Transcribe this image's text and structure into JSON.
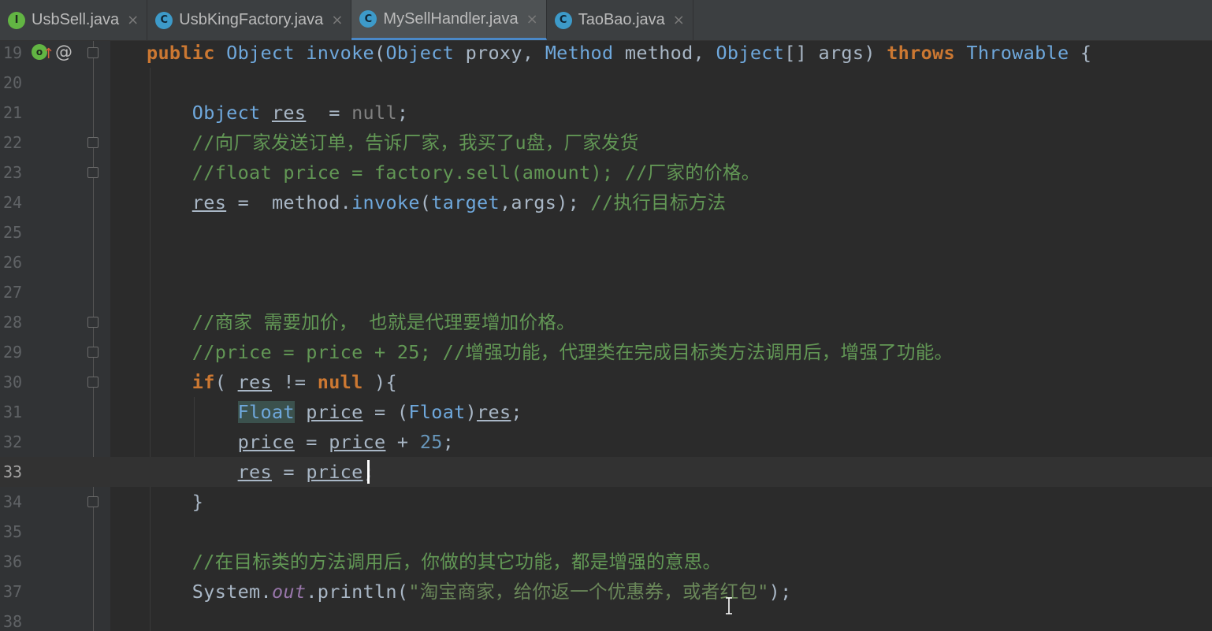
{
  "tabs": [
    {
      "icon": "interface-icon",
      "icon_letter": "I",
      "name": "UsbSell.java",
      "close": "×",
      "active": false
    },
    {
      "icon": "class-icon",
      "icon_letter": "C",
      "name": "UsbKingFactory.java",
      "close": "×",
      "active": false
    },
    {
      "icon": "class-icon",
      "icon_letter": "C",
      "name": "MySellHandler.java",
      "close": "×",
      "active": true
    },
    {
      "icon": "class-icon",
      "icon_letter": "C",
      "name": "TaoBao.java",
      "close": "×",
      "active": false
    }
  ],
  "gutter": {
    "line19_icons": [
      "override-icon",
      "arrow-up-icon",
      "annotation-at-icon"
    ],
    "override_letter": "o",
    "arrow": "↑",
    "at": "@"
  },
  "editor": {
    "current_line": 33,
    "lines": [
      {
        "n": "19",
        "tokens": [
          {
            "t": "public ",
            "c": "kw"
          },
          {
            "t": "Object",
            "c": "tyb"
          },
          {
            "t": " invoke",
            "c": "tyb"
          },
          {
            "t": "(",
            "c": "ty"
          },
          {
            "t": "Object",
            "c": "tyb"
          },
          {
            "t": " proxy, ",
            "c": "ty"
          },
          {
            "t": "Method",
            "c": "tyb"
          },
          {
            "t": " method, ",
            "c": "ty"
          },
          {
            "t": "Object",
            "c": "tyb"
          },
          {
            "t": "[] args) ",
            "c": "ty"
          },
          {
            "t": "throws ",
            "c": "kw"
          },
          {
            "t": "Throwable",
            "c": "tyb"
          },
          {
            "t": " {",
            "c": "ty"
          }
        ]
      },
      {
        "n": "20",
        "tokens": []
      },
      {
        "n": "21",
        "tokens": [
          {
            "t": "    ",
            "c": "ty"
          },
          {
            "t": "Object",
            "c": "tyb"
          },
          {
            "t": " ",
            "c": "ty"
          },
          {
            "t": "res",
            "c": "var"
          },
          {
            "t": "  = ",
            "c": "ty"
          },
          {
            "t": "null",
            "c": "nulg"
          },
          {
            "t": ";",
            "c": "ty"
          }
        ]
      },
      {
        "n": "22",
        "tokens": [
          {
            "t": "    //向厂家发送订单，告诉厂家，我买了u盘，厂家发货",
            "c": "cm"
          }
        ]
      },
      {
        "n": "23",
        "tokens": [
          {
            "t": "    //float price = factory.sell(amount); //厂家的价格。",
            "c": "cm"
          }
        ]
      },
      {
        "n": "24",
        "tokens": [
          {
            "t": "    ",
            "c": "ty"
          },
          {
            "t": "res",
            "c": "var"
          },
          {
            "t": " =  method.",
            "c": "ty"
          },
          {
            "t": "invoke",
            "c": "tyb"
          },
          {
            "t": "(",
            "c": "ty"
          },
          {
            "t": "target",
            "c": "tyb"
          },
          {
            "t": ",args); ",
            "c": "ty"
          },
          {
            "t": "//执行目标方法",
            "c": "cm"
          }
        ]
      },
      {
        "n": "25",
        "tokens": []
      },
      {
        "n": "26",
        "tokens": []
      },
      {
        "n": "27",
        "tokens": []
      },
      {
        "n": "28",
        "tokens": [
          {
            "t": "    //商家 需要加价， 也就是代理要增加价格。",
            "c": "cm"
          }
        ]
      },
      {
        "n": "29",
        "tokens": [
          {
            "t": "    //price = price + 25; //增强功能，代理类在完成目标类方法调用后，增强了功能。",
            "c": "cm"
          }
        ]
      },
      {
        "n": "30",
        "tokens": [
          {
            "t": "    ",
            "c": "ty"
          },
          {
            "t": "if",
            "c": "kw"
          },
          {
            "t": "( ",
            "c": "ty"
          },
          {
            "t": "res",
            "c": "var"
          },
          {
            "t": " != ",
            "c": "ty"
          },
          {
            "t": "null",
            "c": "nul"
          },
          {
            "t": " ){",
            "c": "ty"
          }
        ]
      },
      {
        "n": "31",
        "tokens": [
          {
            "t": "        ",
            "c": "ty"
          },
          {
            "t": "Float",
            "c": "tyb hl"
          },
          {
            "t": " ",
            "c": "ty"
          },
          {
            "t": "price",
            "c": "var"
          },
          {
            "t": " = (",
            "c": "ty"
          },
          {
            "t": "Float",
            "c": "tyb"
          },
          {
            "t": ")",
            "c": "ty"
          },
          {
            "t": "res",
            "c": "var"
          },
          {
            "t": ";",
            "c": "ty"
          }
        ]
      },
      {
        "n": "32",
        "tokens": [
          {
            "t": "        ",
            "c": "ty"
          },
          {
            "t": "price",
            "c": "var"
          },
          {
            "t": " = ",
            "c": "ty"
          },
          {
            "t": "price",
            "c": "var"
          },
          {
            "t": " + ",
            "c": "ty"
          },
          {
            "t": "25",
            "c": "num"
          },
          {
            "t": ";",
            "c": "ty"
          }
        ]
      },
      {
        "n": "33",
        "tokens": [
          {
            "t": "        ",
            "c": "ty"
          },
          {
            "t": "res",
            "c": "var"
          },
          {
            "t": " = ",
            "c": "ty"
          },
          {
            "t": "price",
            "c": "var"
          },
          {
            "t": ";",
            "c": "ty"
          }
        ]
      },
      {
        "n": "34",
        "tokens": [
          {
            "t": "    }",
            "c": "ty"
          }
        ]
      },
      {
        "n": "35",
        "tokens": []
      },
      {
        "n": "36",
        "tokens": [
          {
            "t": "    //在目标类的方法调用后，你做的其它功能，都是增强的意思。",
            "c": "cm"
          }
        ]
      },
      {
        "n": "37",
        "tokens": [
          {
            "t": "    System.",
            "c": "ty"
          },
          {
            "t": "out",
            "c": "stat"
          },
          {
            "t": ".println(",
            "c": "ty"
          },
          {
            "t": "\"淘宝商家，给你返一个优惠券，或者红包\"",
            "c": "str"
          },
          {
            "t": ");",
            "c": "ty"
          }
        ]
      },
      {
        "n": "38",
        "tokens": []
      }
    ]
  }
}
